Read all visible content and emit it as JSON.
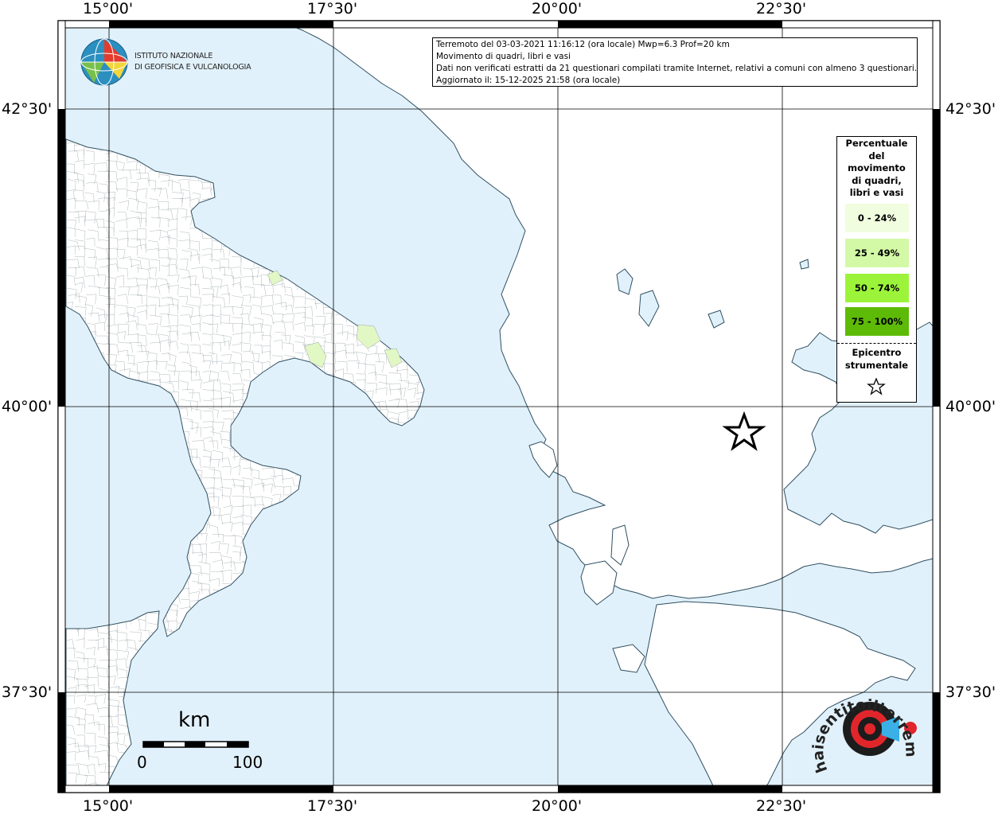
{
  "map": {
    "lon_labels": [
      "15°00'",
      "17°30'",
      "20°00'",
      "22°30'"
    ],
    "lat_labels": [
      "42°30'",
      "40°00'",
      "37°30'"
    ],
    "sea_color": "#e1f1fb",
    "land_color": "#ffffff"
  },
  "info": {
    "line1": "Terremoto del 03-03-2021 11:16:12 (ora locale) Mwp=6.3 Prof=20 km",
    "line2": "Movimento di quadri, libri e vasi",
    "line3": "Dati non verificati estratti da 21 questionari compilati tramite Internet, relativi a comuni con almeno 3 questionari.",
    "line4": "Aggiornato il: 15-12-2025 21:58 (ora locale)"
  },
  "logo": {
    "line1": "ISTITUTO NAZIONALE",
    "line2": "DI GEOFISICA E VULCANOLOGIA",
    "icon": "ingv-globe-icon"
  },
  "legend": {
    "title": [
      "Percentuale",
      "del",
      "movimento",
      "di quadri,",
      "libri e vasi"
    ],
    "items": [
      {
        "label": "0 - 24%",
        "color": "#f0fddf"
      },
      {
        "label": "25 - 49%",
        "color": "#d3f9a6"
      },
      {
        "label": "50 - 74%",
        "color": "#9cf43a"
      },
      {
        "label": "75 - 100%",
        "color": "#5dbb07"
      }
    ],
    "epicenter_label": [
      "Epicentro",
      "strumentale"
    ]
  },
  "scale": {
    "unit": "km",
    "min": "0",
    "max": "100"
  },
  "watermark": {
    "text": "haisentitoilterremoto.it",
    "icon": "haisentito-logo-icon"
  }
}
